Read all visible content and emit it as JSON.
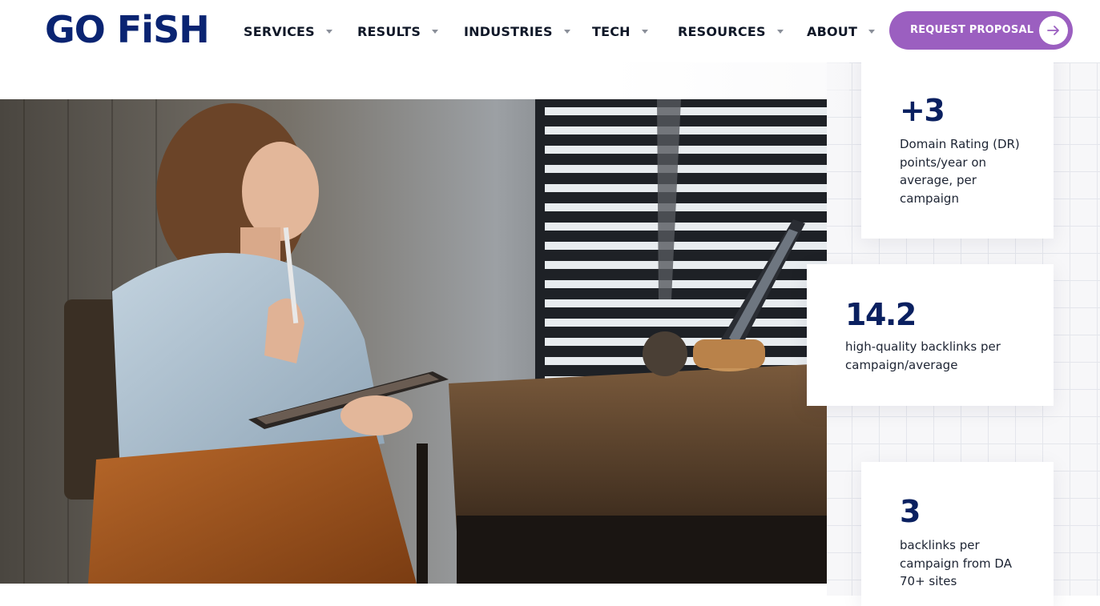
{
  "brand": {
    "logo_text": "GO FiSH",
    "color": "#0a2472"
  },
  "nav": {
    "items": [
      {
        "label": "SERVICES"
      },
      {
        "label": "RESULTS"
      },
      {
        "label": "INDUSTRIES"
      },
      {
        "label": "TECH"
      },
      {
        "label": "RESOURCES"
      },
      {
        "label": "ABOUT"
      }
    ],
    "cta_label": "REQUEST PROPOSAL",
    "cta_color": "#9b5fc0"
  },
  "stats": [
    {
      "value": "+3",
      "description": "Domain Rating (DR) points/year on average, per campaign"
    },
    {
      "value": "14.2",
      "description": "high-quality backlinks per campaign/average"
    },
    {
      "value": "3",
      "description": "backlinks per campaign from DA 70+ sites"
    }
  ]
}
